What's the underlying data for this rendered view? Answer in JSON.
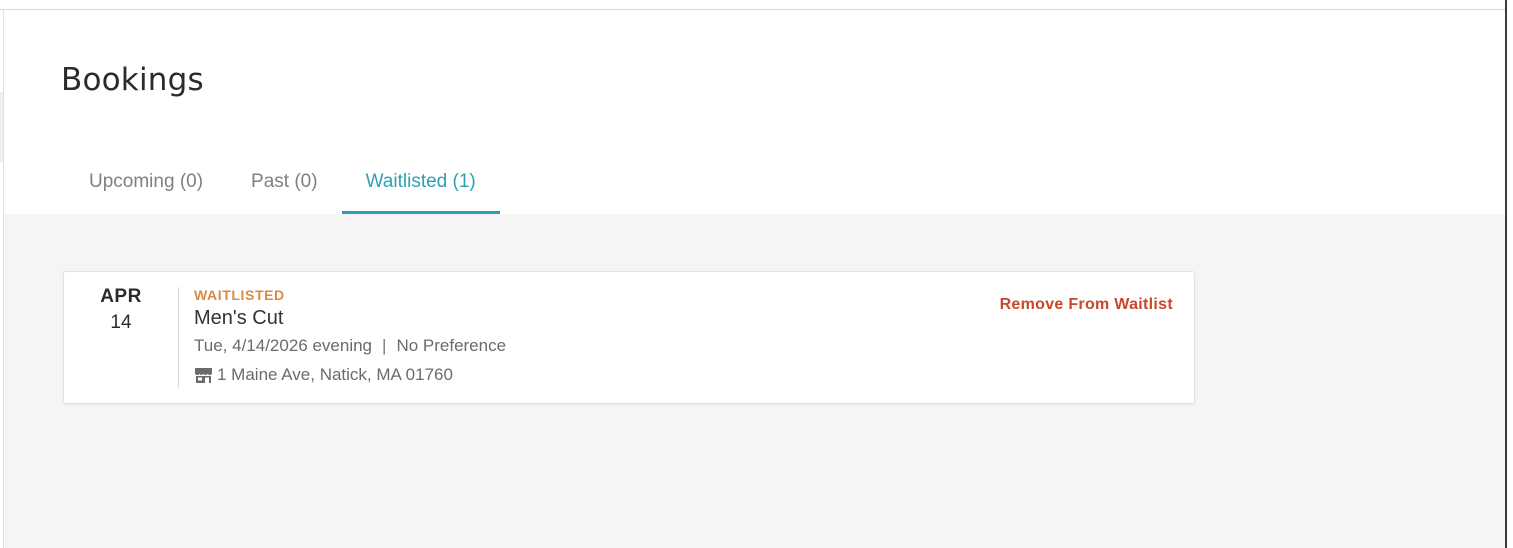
{
  "page": {
    "title": "Bookings"
  },
  "tabs": [
    {
      "label": "Upcoming (0)",
      "active": false
    },
    {
      "label": "Past (0)",
      "active": false
    },
    {
      "label": "Waitlisted (1)",
      "active": true
    }
  ],
  "booking": {
    "month": "APR",
    "day": "14",
    "status": "WAITLISTED",
    "service": "Men's Cut",
    "date_time": "Tue, 4/14/2026 evening",
    "separator": "|",
    "preference": "No Preference",
    "address": "1 Maine Ave, Natick, MA 01760",
    "address_icon": "store-icon",
    "action_label": "Remove From Waitlist"
  },
  "colors": {
    "accent": "#2f9fb5",
    "status": "#d98a45",
    "danger": "#c9482b",
    "background": "#f5f5f5"
  }
}
